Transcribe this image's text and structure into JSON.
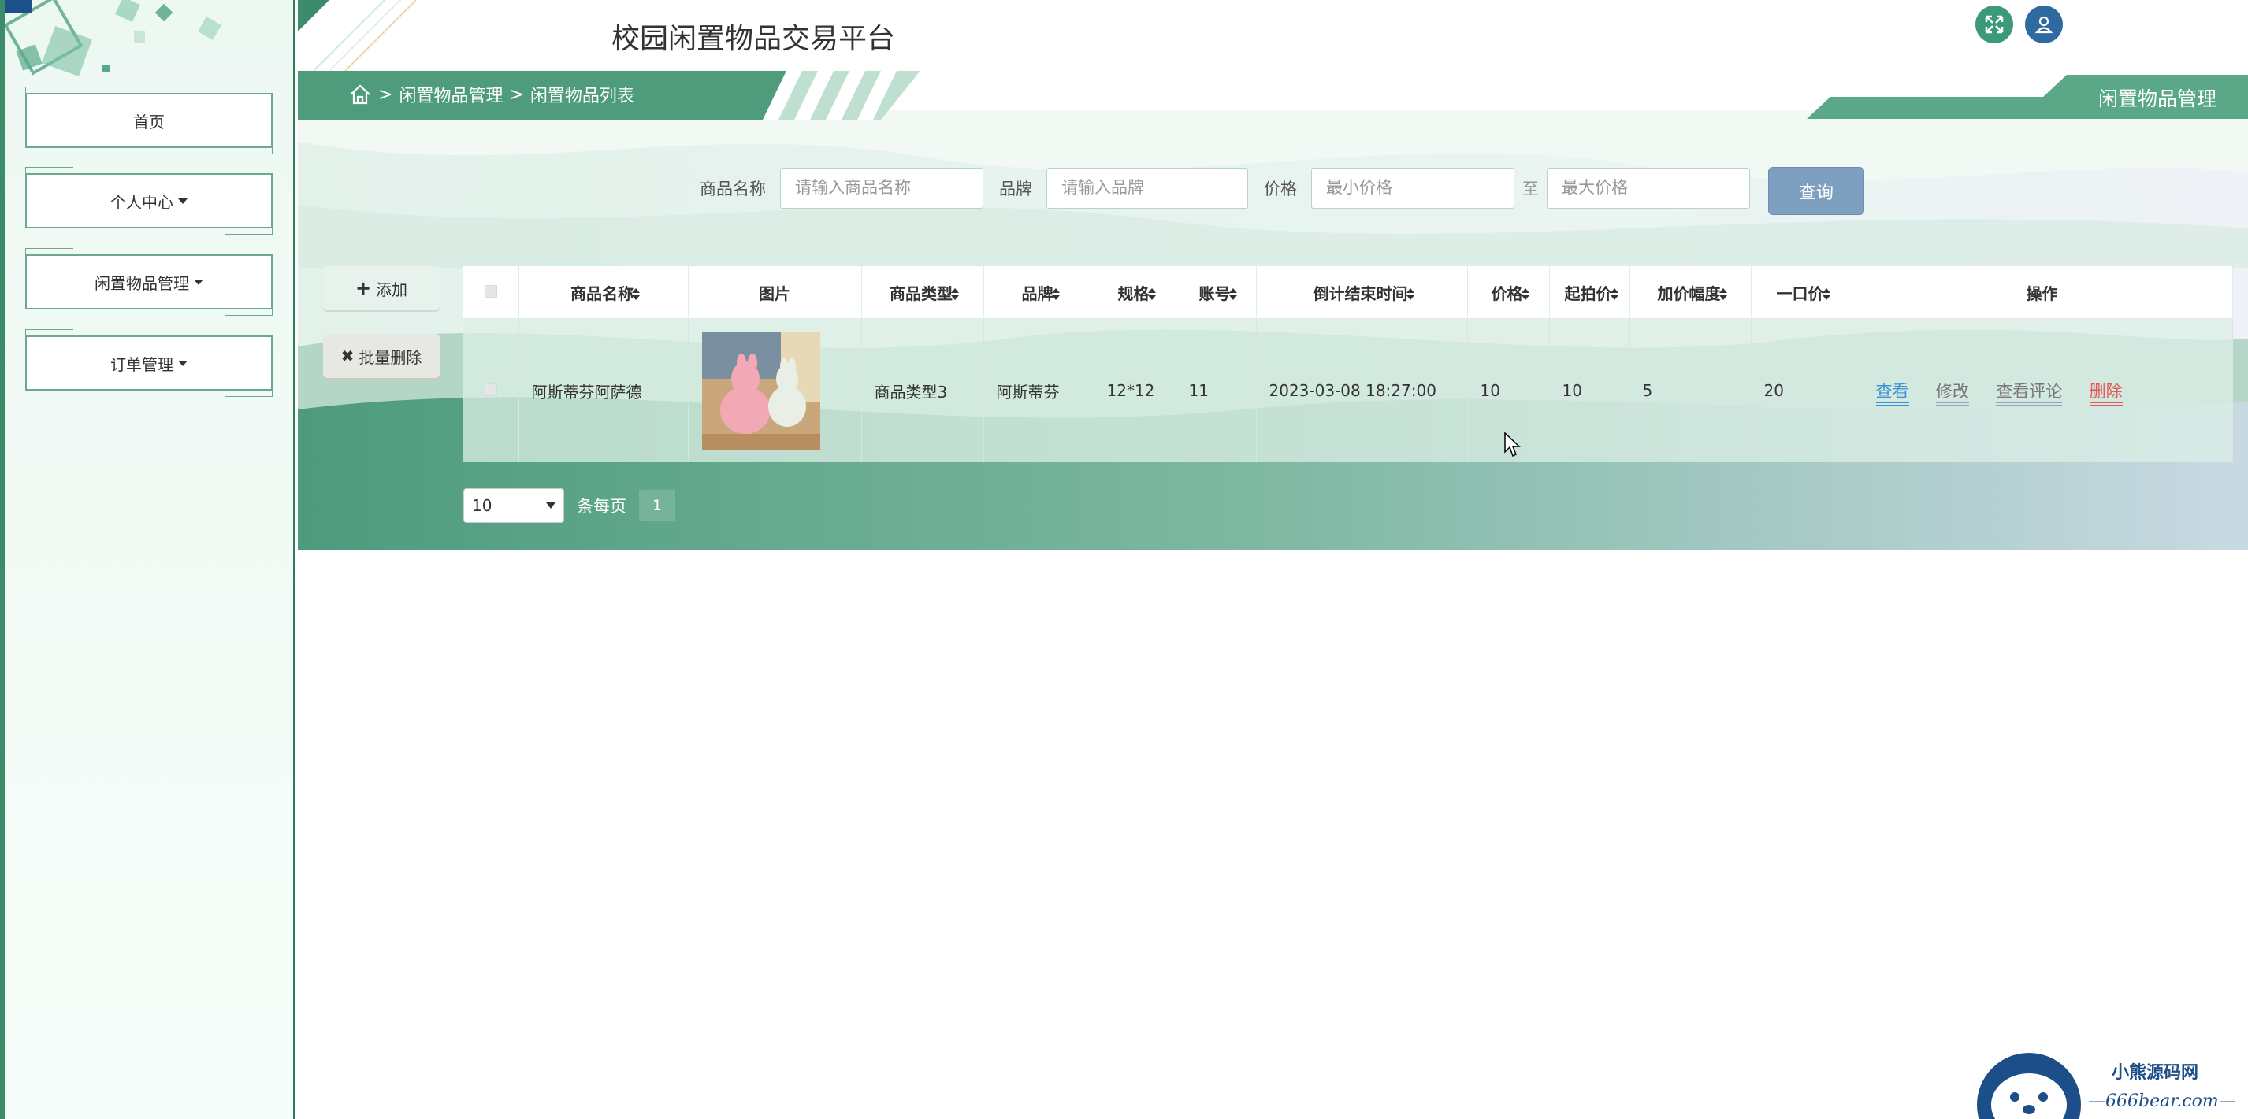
{
  "header": {
    "title": "校园闲置物品交易平台"
  },
  "sidebar": {
    "items": [
      {
        "label": "首页",
        "has_caret": false
      },
      {
        "label": "个人中心",
        "has_caret": true
      },
      {
        "label": "闲置物品管理",
        "has_caret": true
      },
      {
        "label": "订单管理",
        "has_caret": true
      }
    ]
  },
  "breadcrumb": {
    "sep": ">",
    "items": [
      "闲置物品管理",
      "闲置物品列表"
    ]
  },
  "section_tab": "闲置物品管理",
  "search": {
    "name_label": "商品名称",
    "name_placeholder": "请输入商品名称",
    "brand_label": "品牌",
    "brand_placeholder": "请输入品牌",
    "price_label": "价格",
    "min_placeholder": "最小价格",
    "to_label": "至",
    "max_placeholder": "最大价格",
    "query_label": "查询"
  },
  "actions": {
    "add_label": "添加",
    "batch_delete_label": "批量删除"
  },
  "table": {
    "headers": [
      "商品名称",
      "图片",
      "商品类型",
      "品牌",
      "规格",
      "账号",
      "倒计结束时间",
      "价格",
      "起拍价",
      "加价幅度",
      "一口价",
      "操作"
    ],
    "rows": [
      {
        "name": "阿斯蒂芬阿萨德",
        "image": "pink-llama-plush-photo",
        "type": "商品类型3",
        "brand": "阿斯蒂芬",
        "spec": "12*12",
        "account": "11",
        "end_time": "2023-03-08 18:27:00",
        "price": "10",
        "start_price": "10",
        "increment": "5",
        "buyout": "20"
      }
    ],
    "row_actions": [
      "查看",
      "修改",
      "查看评论",
      "删除"
    ]
  },
  "pagination": {
    "page_size": "10",
    "per_page_label": "条每页",
    "current_page": "1"
  },
  "watermark": {
    "title": "小熊源码网",
    "url": "—666bear.com—"
  },
  "colors": {
    "accent": "#3c8b6a",
    "query": "#7ea0c0",
    "view": "#3b8fd4",
    "delete": "#e05a5a"
  }
}
